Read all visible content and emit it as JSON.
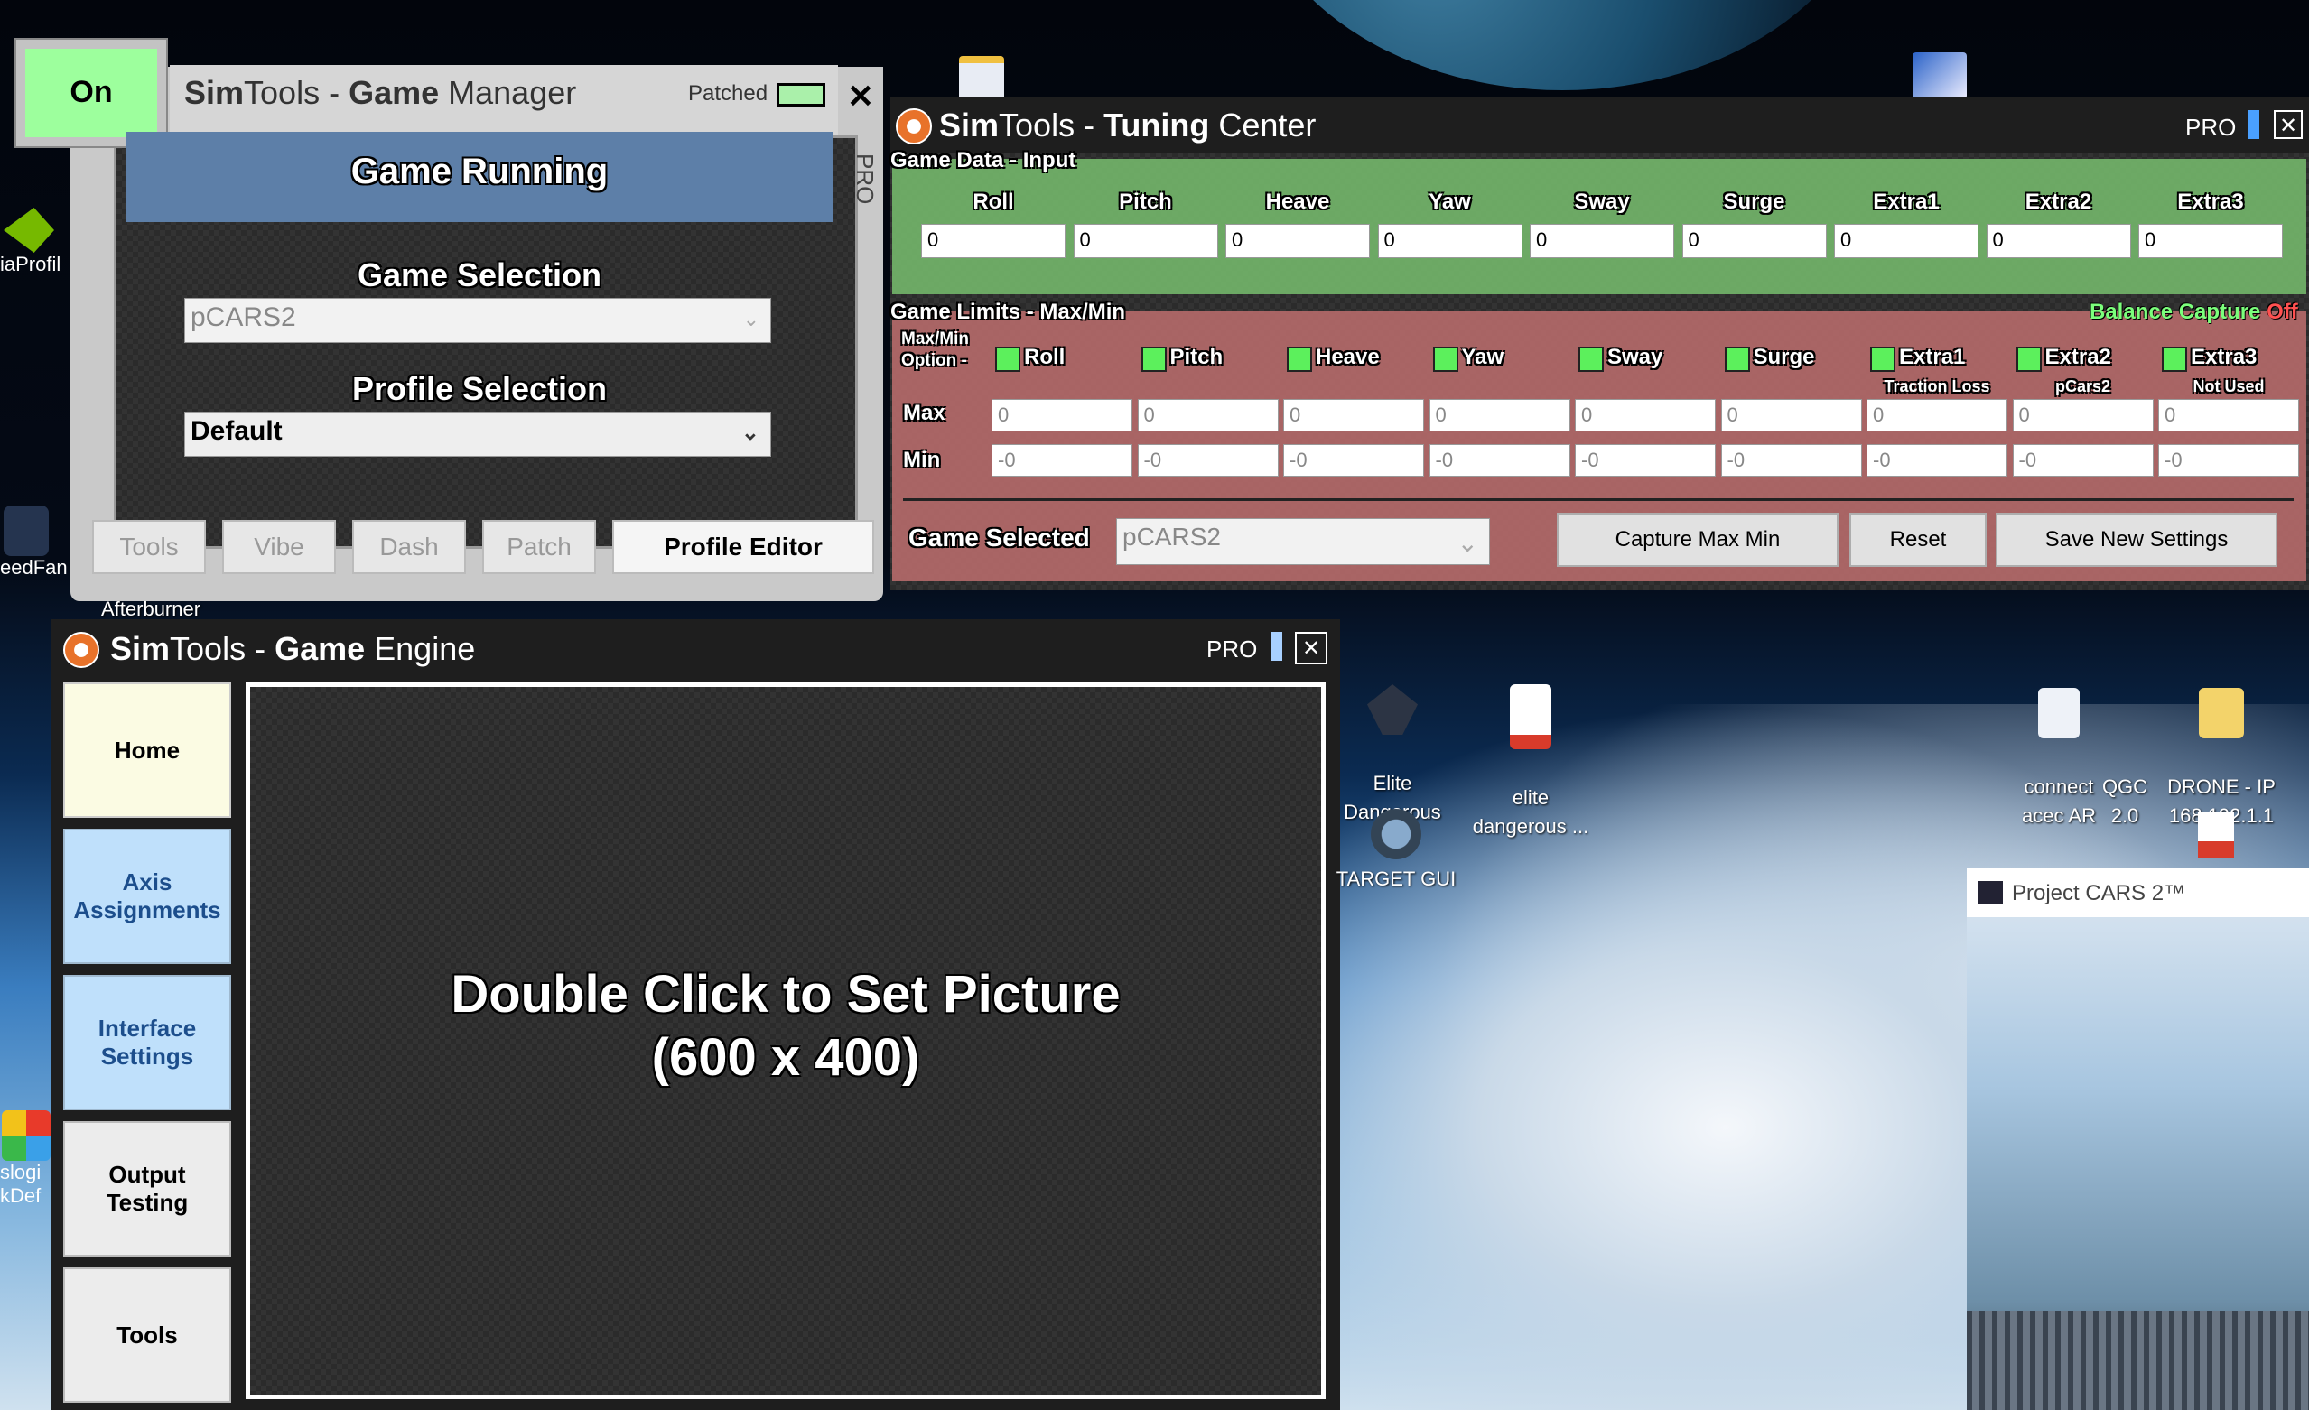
{
  "desktop": {
    "left_icons": [
      "iaProfil",
      "eedFan",
      "Afterburner",
      "slogi",
      "kDef"
    ],
    "icons": [
      {
        "name": "elite-dangerous-shortcut",
        "label": "Elite\nDangerous"
      },
      {
        "name": "elite-dangerous-pdf",
        "label": "elite\ndangerous ..."
      },
      {
        "name": "target-gui-shortcut",
        "label": "TARGET GUI"
      },
      {
        "name": "connect-acec-ar",
        "label": "connect\nacec AR"
      },
      {
        "name": "qgc-2",
        "label": "QGC\n2.0"
      },
      {
        "name": "drone-ip",
        "label": "DRONE - IP\n168.192.1.1"
      }
    ]
  },
  "game_manager": {
    "title_bold": "Sim",
    "title_mid": "Tools - ",
    "title_bold2": "Game",
    "title_rest": " Manager",
    "on_button": "On",
    "patched_label": "Patched",
    "close": "✕",
    "pro_side": "PRO",
    "status": "Game Running",
    "game_selection_label": "Game Selection",
    "game_selection_value": "pCARS2",
    "profile_selection_label": "Profile Selection",
    "profile_selection_value": "Default",
    "buttons": [
      "Tools",
      "Vibe",
      "Dash",
      "Patch"
    ],
    "profile_editor": "Profile Editor"
  },
  "tuning_center": {
    "title_bold": "Sim",
    "title_mid": "Tools - ",
    "title_bold2": "Tuning",
    "title_rest": " Center",
    "pro": "PRO",
    "close": "✕",
    "game_data_label": "Game Data - Input",
    "axes": [
      "Roll",
      "Pitch",
      "Heave",
      "Yaw",
      "Sway",
      "Surge",
      "Extra1",
      "Extra2",
      "Extra3"
    ],
    "input_values": [
      "0",
      "0",
      "0",
      "0",
      "0",
      "0",
      "0",
      "0",
      "0"
    ],
    "limits_label": "Game Limits - Max/Min",
    "balance_capture": "Balance Capture",
    "balance_state": "Off",
    "option_label_1": "Max/Min",
    "option_label_2": "Option -",
    "sublabels": [
      "",
      "",
      "",
      "",
      "",
      "",
      "Traction Loss",
      "pCars2",
      "Not Used"
    ],
    "max_label": "Max",
    "min_label": "Min",
    "max_values": [
      "0",
      "0",
      "0",
      "0",
      "0",
      "0",
      "0",
      "0",
      "0"
    ],
    "min_values": [
      "-0",
      "-0",
      "-0",
      "-0",
      "-0",
      "-0",
      "-0",
      "-0",
      "-0"
    ],
    "game_selected_label": "Game Selected",
    "game_selected_value": "pCARS2",
    "capture_button": "Capture Max Min",
    "reset_button": "Reset",
    "save_button": "Save New Settings"
  },
  "game_engine": {
    "title_bold": "Sim",
    "title_mid": "Tools - ",
    "title_bold2": "Game",
    "title_rest": " Engine",
    "pro": "PRO",
    "close": "✕",
    "nav": [
      "Home",
      "Axis\nAssignments",
      "Interface\nSettings",
      "Output\nTesting",
      "Tools"
    ],
    "picture_line1": "Double Click to Set Picture",
    "picture_line2": "(600 x 400)"
  },
  "project_cars": {
    "title": "Project CARS 2™"
  }
}
